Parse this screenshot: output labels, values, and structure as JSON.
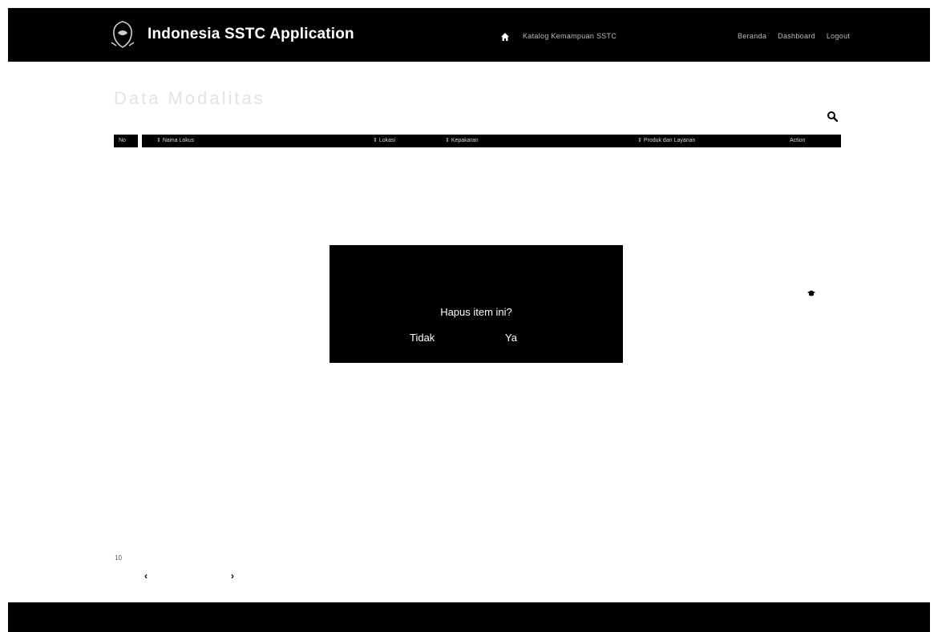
{
  "header": {
    "brand": "Indonesia SSTC Application",
    "home_label": "Katalog Kemampuan SSTC",
    "nav_items": [
      "Beranda",
      "Dashboard",
      "Logout"
    ]
  },
  "page": {
    "title": "Data Modalitas"
  },
  "table": {
    "columns": [
      "No",
      "Nama Lokus",
      "Lokasi",
      "Kepakaran",
      "Produk dan Layanan",
      "Action"
    ]
  },
  "dialog": {
    "message": "Hapus item ini?",
    "cancel_label": "Tidak",
    "confirm_label": "Ya"
  },
  "pagination": {
    "info": "10",
    "prev_label": "‹",
    "next_label": "›"
  },
  "colors": {
    "bar": "#000000",
    "background": "#ffffff",
    "text_light": "#ffffff"
  },
  "icons": [
    "logo-icon",
    "home-icon",
    "search-icon",
    "graduation-cap-icon"
  ]
}
